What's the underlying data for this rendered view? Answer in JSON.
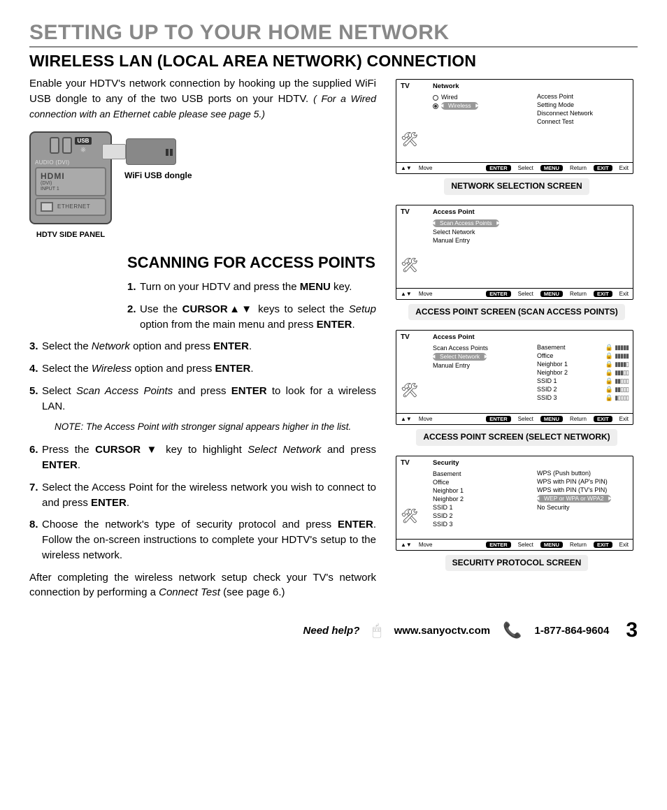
{
  "titles": {
    "main": "SETTING UP TO YOUR HOME NETWORK",
    "sub": "WIRELESS LAN (LOCAL AREA NETWORK) CONNECTION",
    "scan": "SCANNING FOR ACCESS POINTS"
  },
  "intro": {
    "body": "Enable your HDTV's network connection by hooking up the supplied WiFi USB dongle to any of the two USB ports on your HDTV. ",
    "note": "( For a Wired connection with an Ethernet cable please see page 5.)"
  },
  "figure": {
    "usb_badge": "USB",
    "audio_label": "AUDIO (DVI)",
    "hdmi": "HDMI",
    "hdmi_sub1": "(DVI)",
    "hdmi_sub2": "INPUT 1",
    "ethernet": "ETHERNET",
    "panel_caption": "HDTV SIDE PANEL",
    "dongle_caption": "WiFi USB dongle"
  },
  "steps": {
    "s1a": "Turn on your HDTV and press the ",
    "s1b": "MENU",
    "s1c": " key.",
    "s2a": "Use the ",
    "s2b": "CURSOR",
    "s2c": "▲▼",
    "s2d": " keys to select the ",
    "s2e": "Setup",
    "s2f": " option from the main menu and press ",
    "s2g": "ENTER",
    "s2h": ".",
    "s3a": "Select the ",
    "s3b": "Network",
    "s3c": " option and press ",
    "s3d": "ENTER",
    "s3e": ".",
    "s4a": "Select the ",
    "s4b": "Wireless",
    "s4c": " option and press ",
    "s4d": "ENTER",
    "s4e": ".",
    "s5a": "Select ",
    "s5b": "Scan Access Points ",
    "s5c": " and press ",
    "s5d": "ENTER",
    "s5e": " to look for a wireless LAN.",
    "note": "NOTE: The Access Point with stronger signal appears higher in the list.",
    "s6a": "Press the ",
    "s6b": "CURSOR ▼",
    "s6c": " key to highlight ",
    "s6d": "Select Network",
    "s6e": " and press ",
    "s6f": "ENTER",
    "s6g": ".",
    "s7a": "Select the Access Point for the wireless network you wish to connect to and press ",
    "s7b": "ENTER",
    "s7c": ".",
    "s8a": "Choose the network's type of security protocol and press ",
    "s8b": "ENTER",
    "s8c": ". Follow the on-screen instructions to complete your HDTV's setup to the wireless network."
  },
  "after": {
    "a": "After completing the wireless network setup check your TV's network connection by performing a ",
    "b": "Connect Test",
    "c": " (see page 6.)"
  },
  "screens": {
    "brand": "TV",
    "foot": {
      "move": "Move",
      "enter": "ENTER",
      "select": "Select",
      "menu": "MENU",
      "return": "Return",
      "exit": "EXIT",
      "exit2": "Exit"
    },
    "network": {
      "title": "Network",
      "left": {
        "wired": "Wired",
        "wireless": "Wireless"
      },
      "right": [
        "Access Point",
        "Setting Mode",
        "Disconnect Network",
        "Connect Test"
      ],
      "caption": "NETWORK SELECTION SCREEN"
    },
    "ap_scan": {
      "title": "Access Point",
      "items": {
        "scan": "Scan Access Points",
        "select": "Select Network",
        "manual": "Manual Entry"
      },
      "caption": "ACCESS POINT SCREEN (SCAN ACCESS POINTS)"
    },
    "ap_select": {
      "title": "Access Point",
      "left": {
        "scan": "Scan Access Points",
        "select": "Select Network",
        "manual": "Manual Entry"
      },
      "networks": [
        "Basement",
        "Office",
        "Neighbor 1",
        "Neighbor 2",
        "SSID 1",
        "SSID 2",
        "SSID 3"
      ],
      "caption": "ACCESS POINT SCREEN (SELECT NETWORK)"
    },
    "security": {
      "title": "Security",
      "left": [
        "Basement",
        "Office",
        "Neighbor 1",
        "Neighbor 2",
        "SSID 1",
        "SSID 2",
        "SSID 3"
      ],
      "right": {
        "r1": "WPS (Push button)",
        "r2": "WPS with PIN (AP's PIN)",
        "r3": "WPS with PIN (TV's PIN)",
        "r4": "WEP or WPA or WPA2",
        "r5": "No Security"
      },
      "caption": "SECURITY PROTOCOL SCREEN"
    }
  },
  "footer": {
    "need": "Need help?",
    "url": "www.sanyoctv.com",
    "phone": "1-877-864-9604",
    "page": "3"
  }
}
